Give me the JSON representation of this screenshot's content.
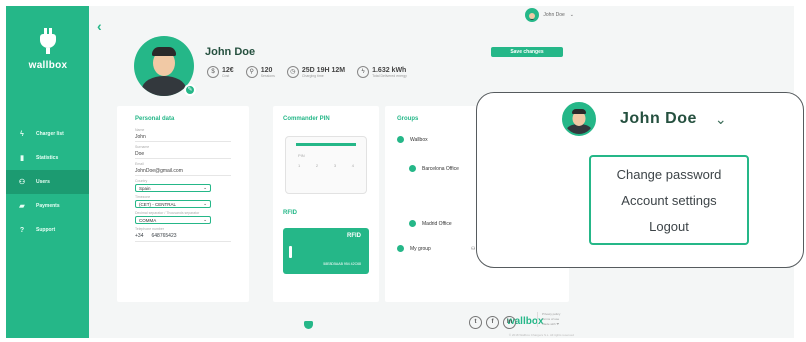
{
  "brand": {
    "name": "wallbox"
  },
  "sidebar": {
    "items": [
      {
        "label": "Charger list",
        "icon": "bolt-icon"
      },
      {
        "label": "Statistics",
        "icon": "bar-chart-icon"
      },
      {
        "label": "Users",
        "icon": "users-icon"
      },
      {
        "label": "Payments",
        "icon": "wallet-icon"
      },
      {
        "label": "Support",
        "icon": "question-icon"
      }
    ],
    "active_index": 2
  },
  "top_user": {
    "name": "John Doe"
  },
  "profile": {
    "name": "John Doe",
    "save_label": "Save changes",
    "stats": [
      {
        "icon": "$",
        "value": "12€",
        "label": "Cost"
      },
      {
        "icon": "⚲",
        "value": "120",
        "label": "Sessions"
      },
      {
        "icon": "◷",
        "value": "25D 19H 12M",
        "label": "Charging time"
      },
      {
        "icon": "ϟ",
        "value": "1.632 kWh",
        "label": "Total Delivered energy"
      }
    ]
  },
  "personal": {
    "title": "Personal data",
    "fields": [
      {
        "label": "Name",
        "value": "John"
      },
      {
        "label": "Surname",
        "value": "Doe"
      },
      {
        "label": "Email",
        "value": "JohnDoe@gmail.com"
      }
    ],
    "country": {
      "label": "Country",
      "value": "Spain"
    },
    "timezone": {
      "label": "Timezone",
      "value": "(CET) - CENTRAL"
    },
    "separator": {
      "label": "Decimal separator / Thousands separator",
      "value": "COMMA"
    },
    "phone": {
      "label": "Telephone number",
      "prefix": "+34",
      "value": "648765423"
    }
  },
  "commander": {
    "title": "Commander PIN",
    "pin_label": "PIN",
    "digits": [
      "1",
      "2",
      "3",
      "4"
    ]
  },
  "rfid": {
    "title": "RFID",
    "card_title": "RFID",
    "card_number": "58E8D5AAB 954 42C68"
  },
  "groups": {
    "title": "Groups",
    "items": [
      "Wallbox",
      "Barcelona Office",
      "Madrid Office",
      "My group"
    ],
    "role": "No assigned"
  },
  "footer": {
    "brand": "wallbox",
    "copyright": "© 2018 Wallbox Chargers S.L. All rights reserved",
    "legal": [
      "Privacy policy",
      "Terms of use",
      "Made with ❤"
    ]
  },
  "popup": {
    "name": "John Doe",
    "menu": [
      "Change password",
      "Account settings",
      "Logout"
    ]
  }
}
